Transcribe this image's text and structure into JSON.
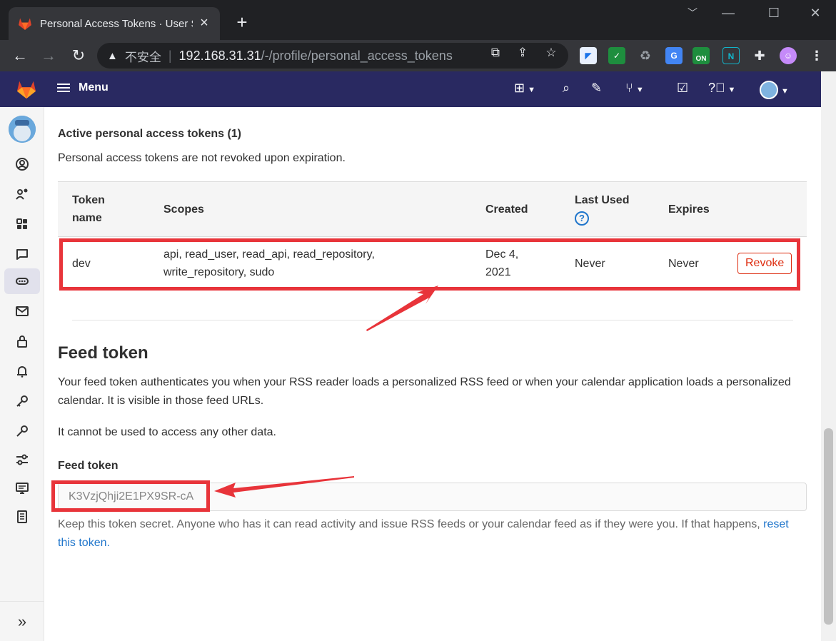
{
  "browser": {
    "tab_title": "Personal Access Tokens · User S",
    "tab_close": "×",
    "new_tab": "+",
    "window_controls": {
      "minimize": "﹀",
      "restore": "—",
      "maximize": "☐",
      "close": "✕"
    },
    "address": {
      "security_label": "不安全",
      "host": "192.168.31.31",
      "path": "/-/profile/personal_access_tokens"
    },
    "extension_badge": "ON"
  },
  "gitlab_nav": {
    "menu_label": "Menu"
  },
  "active_tokens": {
    "heading": "Active personal access tokens (1)",
    "note": "Personal access tokens are not revoked upon expiration.",
    "columns": {
      "token_name": "Token name",
      "scopes": "Scopes",
      "created": "Created",
      "last_used": "Last Used",
      "expires": "Expires"
    },
    "rows": [
      {
        "token_name": "dev",
        "scopes": "api, read_user, read_api, read_repository, write_repository, sudo",
        "created": "Dec 4, 2021",
        "last_used": "Never",
        "expires": "Never",
        "action_label": "Revoke"
      }
    ]
  },
  "feed_token": {
    "heading": "Feed token",
    "description": "Your feed token authenticates you when your RSS reader loads a personalized RSS feed or when your calendar application loads a personalized calendar. It is visible in those feed URLs.",
    "note": "It cannot be used to access any other data.",
    "label": "Feed token",
    "value": "K3VzjQhji2E1PX9SR-cA",
    "help_text": "Keep this token secret. Anyone who has it can read activity and issue RSS feeds or your calendar feed as if they were you. If that happens,",
    "reset_link": "reset this token."
  },
  "colors": {
    "gitlab_nav": "#292961",
    "annotation_red": "#e8343a",
    "revoke_red": "#dd2b0e",
    "link_blue": "#1f75cb"
  },
  "icons": {
    "sidebar": [
      "user-icon",
      "user-settings-icon",
      "applications-icon",
      "comment-icon",
      "token-icon",
      "mail-icon",
      "lock-icon",
      "notifications-icon",
      "key-icon",
      "gpg-key-icon",
      "preferences-icon",
      "sessions-icon",
      "log-icon"
    ],
    "navbar": [
      "plus-square-icon",
      "search-icon",
      "issues-icon",
      "merge-request-icon",
      "todo-icon",
      "help-icon",
      "avatar"
    ]
  }
}
